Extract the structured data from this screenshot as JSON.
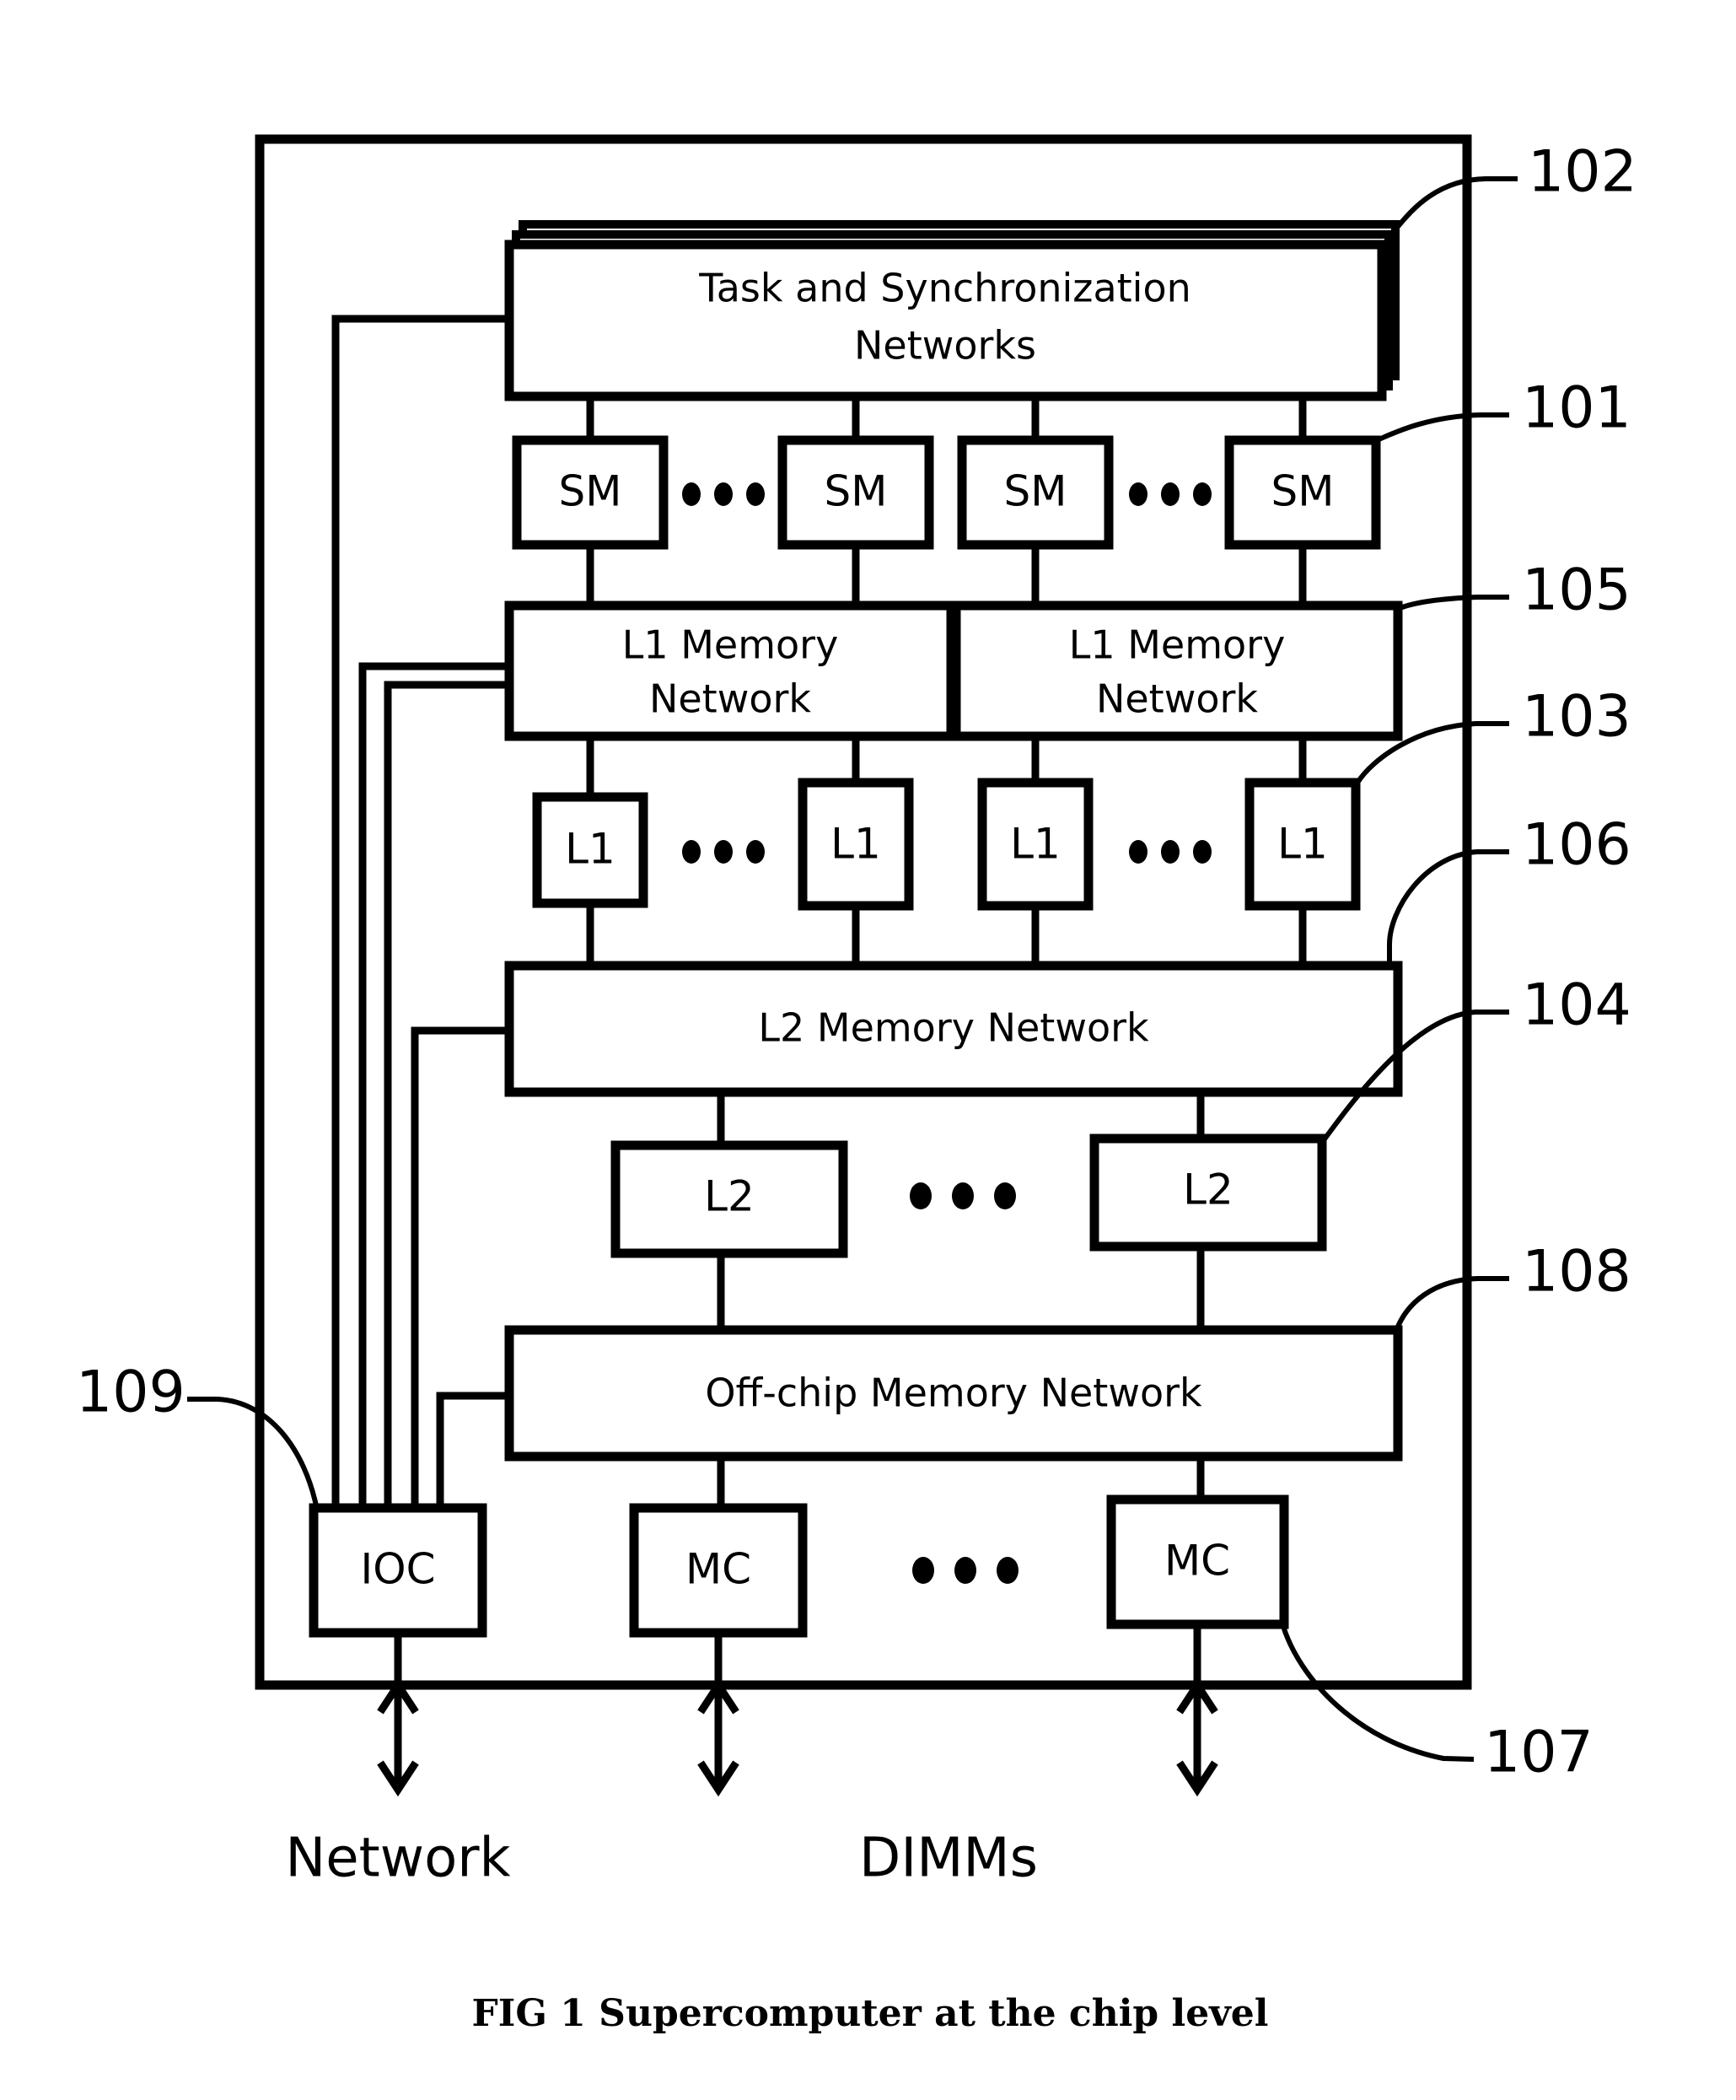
{
  "figure": {
    "caption_label": "FIG 1",
    "caption_text": "Supercomputer at the chip level",
    "background_color": "#ffffff",
    "line_color": "#000000"
  },
  "blocks": {
    "task_sync": "Task and Synchronization Networks",
    "task_sync_line1": "Task and Synchronization",
    "task_sync_line2": "Networks",
    "l1_memory_network_left_line1": "L1 Memory",
    "l1_memory_network_left_line2": "Network",
    "l1_memory_network_right_line1": "L1 Memory",
    "l1_memory_network_right_line2": "Network",
    "l2_memory_network": "L2 Memory Network",
    "offchip_memory_network": "Off-chip Memory Network"
  },
  "sm_row": [
    "SM",
    "SM",
    "SM",
    "SM"
  ],
  "l1_row": [
    "L1",
    "L1",
    "L1",
    "L1"
  ],
  "l2_row": [
    "L2",
    "L2"
  ],
  "controller_row": [
    "IOC",
    "MC",
    "MC"
  ],
  "reference_numbers": [
    {
      "id": "102",
      "label": "102"
    },
    {
      "id": "101",
      "label": "101"
    },
    {
      "id": "105",
      "label": "105"
    },
    {
      "id": "103",
      "label": "103"
    },
    {
      "id": "106",
      "label": "106"
    },
    {
      "id": "104",
      "label": "104"
    },
    {
      "id": "108",
      "label": "108"
    },
    {
      "id": "109",
      "label": "109"
    },
    {
      "id": "107",
      "label": "107"
    }
  ],
  "external_labels": {
    "network": "Network",
    "dimms": "DIMMs"
  }
}
